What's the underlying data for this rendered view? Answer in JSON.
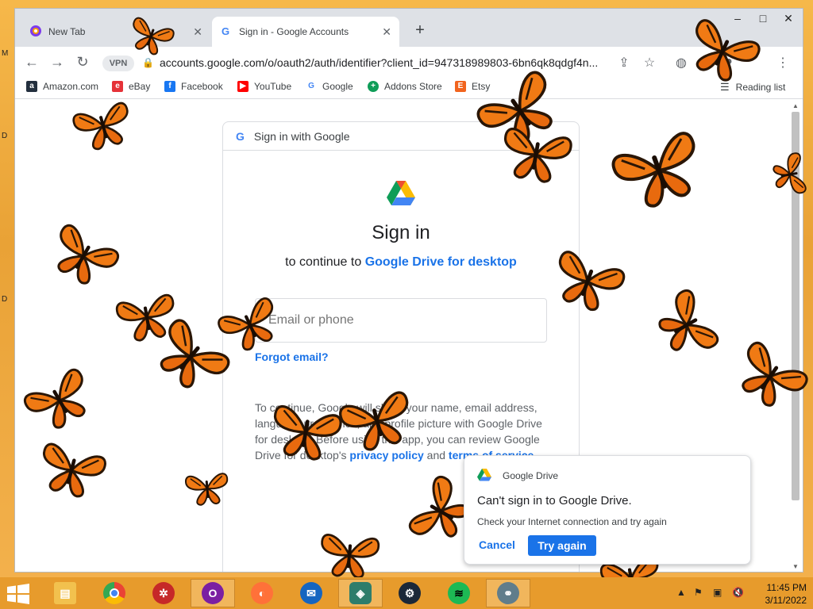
{
  "tabs": [
    {
      "title": "New Tab",
      "icon": "opera-icon"
    },
    {
      "title": "Sign in - Google Accounts",
      "icon": "google-icon"
    }
  ],
  "address_bar": {
    "vpn_label": "VPN",
    "url": "accounts.google.com/o/oauth2/auth/identifier?client_id=947318989803-6bn6qk8qdgf4n..."
  },
  "bookmarks": [
    {
      "label": "Amazon.com",
      "icon": "amazon-icon",
      "color": "#232f3e",
      "glyph": "a"
    },
    {
      "label": "eBay",
      "icon": "ebay-icon",
      "color": "#e53238",
      "glyph": "e"
    },
    {
      "label": "Facebook",
      "icon": "facebook-icon",
      "color": "#1877f2",
      "glyph": "f"
    },
    {
      "label": "YouTube",
      "icon": "youtube-icon",
      "color": "#ff0000",
      "glyph": "▶"
    },
    {
      "label": "Google",
      "icon": "google-icon",
      "color": "#4285f4",
      "glyph": "G"
    },
    {
      "label": "Addons Store",
      "icon": "addons-icon",
      "color": "#0f9d58",
      "glyph": "+"
    },
    {
      "label": "Etsy",
      "icon": "etsy-icon",
      "color": "#f1641e",
      "glyph": "E"
    }
  ],
  "reading_list": "Reading list",
  "signin": {
    "header": "Sign in with Google",
    "title": "Sign in",
    "subtitle_prefix": "to continue to ",
    "app_name": "Google Drive for desktop",
    "email_placeholder": "Email or phone",
    "forgot": "Forgot email?",
    "disclaimer_text": "To continue, Google will share your name, email address, language preference, and profile picture with Google Drive for desktop. Before using this app, you can review Google Drive for desktop's ",
    "privacy_link": "privacy policy",
    "and": " and ",
    "terms_link": "terms of service",
    "end": "."
  },
  "notification": {
    "app": "Google Drive",
    "title": "Can't sign in to Google Drive.",
    "body": "Check your Internet connection and try again",
    "cancel": "Cancel",
    "retry": "Try again"
  },
  "desktop_letters": [
    "M",
    "D",
    "D"
  ],
  "taskbar": {
    "apps": [
      {
        "name": "file-explorer",
        "color": "#f2c14e",
        "glyph": "▤"
      },
      {
        "name": "chrome",
        "color": "#4285f4",
        "glyph": "◉"
      },
      {
        "name": "app-red",
        "color": "#c62828",
        "glyph": "✲"
      },
      {
        "name": "opera",
        "color": "#7b1fa2",
        "glyph": "O"
      },
      {
        "name": "firefox",
        "color": "#ff7139",
        "glyph": "◐"
      },
      {
        "name": "thunderbird",
        "color": "#1565c0",
        "glyph": "✉"
      },
      {
        "name": "app-shield",
        "color": "#2e7d6b",
        "glyph": "◈"
      },
      {
        "name": "steam",
        "color": "#1b2838",
        "glyph": "⚙"
      },
      {
        "name": "spotify",
        "color": "#1db954",
        "glyph": "≋"
      },
      {
        "name": "app-network",
        "color": "#607d8b",
        "glyph": "⚭"
      }
    ],
    "time": "11:45 PM",
    "date": "3/11/2022"
  }
}
